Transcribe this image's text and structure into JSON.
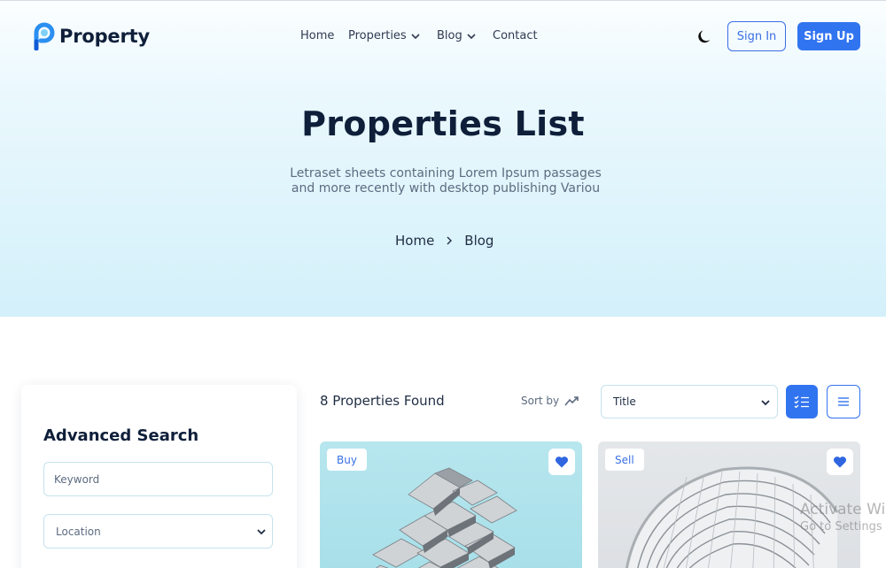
{
  "header": {
    "logo_text": "Property",
    "nav": [
      {
        "label": "Home"
      },
      {
        "label": "Properties"
      },
      {
        "label": "Blog"
      },
      {
        "label": "Contact"
      }
    ],
    "signin_label": "Sign In",
    "signup_label": "Sign Up"
  },
  "hero": {
    "title": "Properties List",
    "subtitle_line1": "Letraset sheets containing Lorem Ipsum passages",
    "subtitle_line2": "and more recently with desktop publishing Variou",
    "breadcrumb": [
      "Home",
      "Blog"
    ]
  },
  "sidebar": {
    "title": "Advanced Search",
    "keyword_placeholder": "Keyword",
    "location_value": "Location"
  },
  "listing": {
    "found_text": "8 Properties Found",
    "sort_label": "Sort by",
    "sort_select_value": "Title",
    "cards": [
      {
        "tag": "Buy"
      },
      {
        "tag": "Sell"
      }
    ]
  },
  "watermark": {
    "line1": "Activate Windows",
    "line2": "Go to Settings to activate Windows."
  },
  "colors": {
    "accent": "#3174f0",
    "dark_text": "#0f1f3a",
    "hero_bg": "#d3f0fa"
  },
  "icons": [
    "logo-p-icon",
    "chevron-down-icon",
    "moon-icon",
    "chevron-right-icon",
    "trend-up-icon",
    "checklist-icon",
    "list-icon",
    "heart-icon"
  ]
}
